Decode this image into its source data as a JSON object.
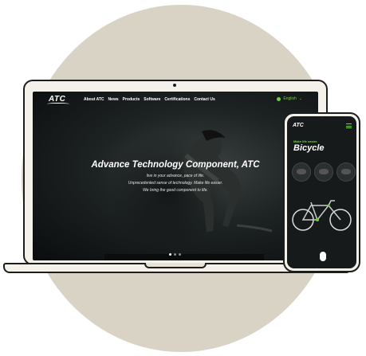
{
  "laptop": {
    "nav": {
      "logo": "ATC",
      "links": [
        "About ATC",
        "News",
        "Products",
        "Software",
        "Certifications",
        "Contact Us"
      ],
      "language": "English"
    },
    "hero": {
      "title": "Advance Technology Component, ATC",
      "lines": [
        "live in your advance, pace of life.",
        "Unprecedented sense of technology. Make life easier.",
        "We bring the good component to life."
      ]
    }
  },
  "phone": {
    "logo": "ATC",
    "tagline": "Make life easier.",
    "title": "Bicycle"
  },
  "colors": {
    "background_circle": "#d9d3c6",
    "device_frame": "#f4f1ea",
    "accent_green": "#6fd23c",
    "screen_dark": "#161a1a"
  },
  "icons": [
    "globe-icon",
    "chevron-down-icon",
    "menu-icon",
    "camera-icon"
  ]
}
